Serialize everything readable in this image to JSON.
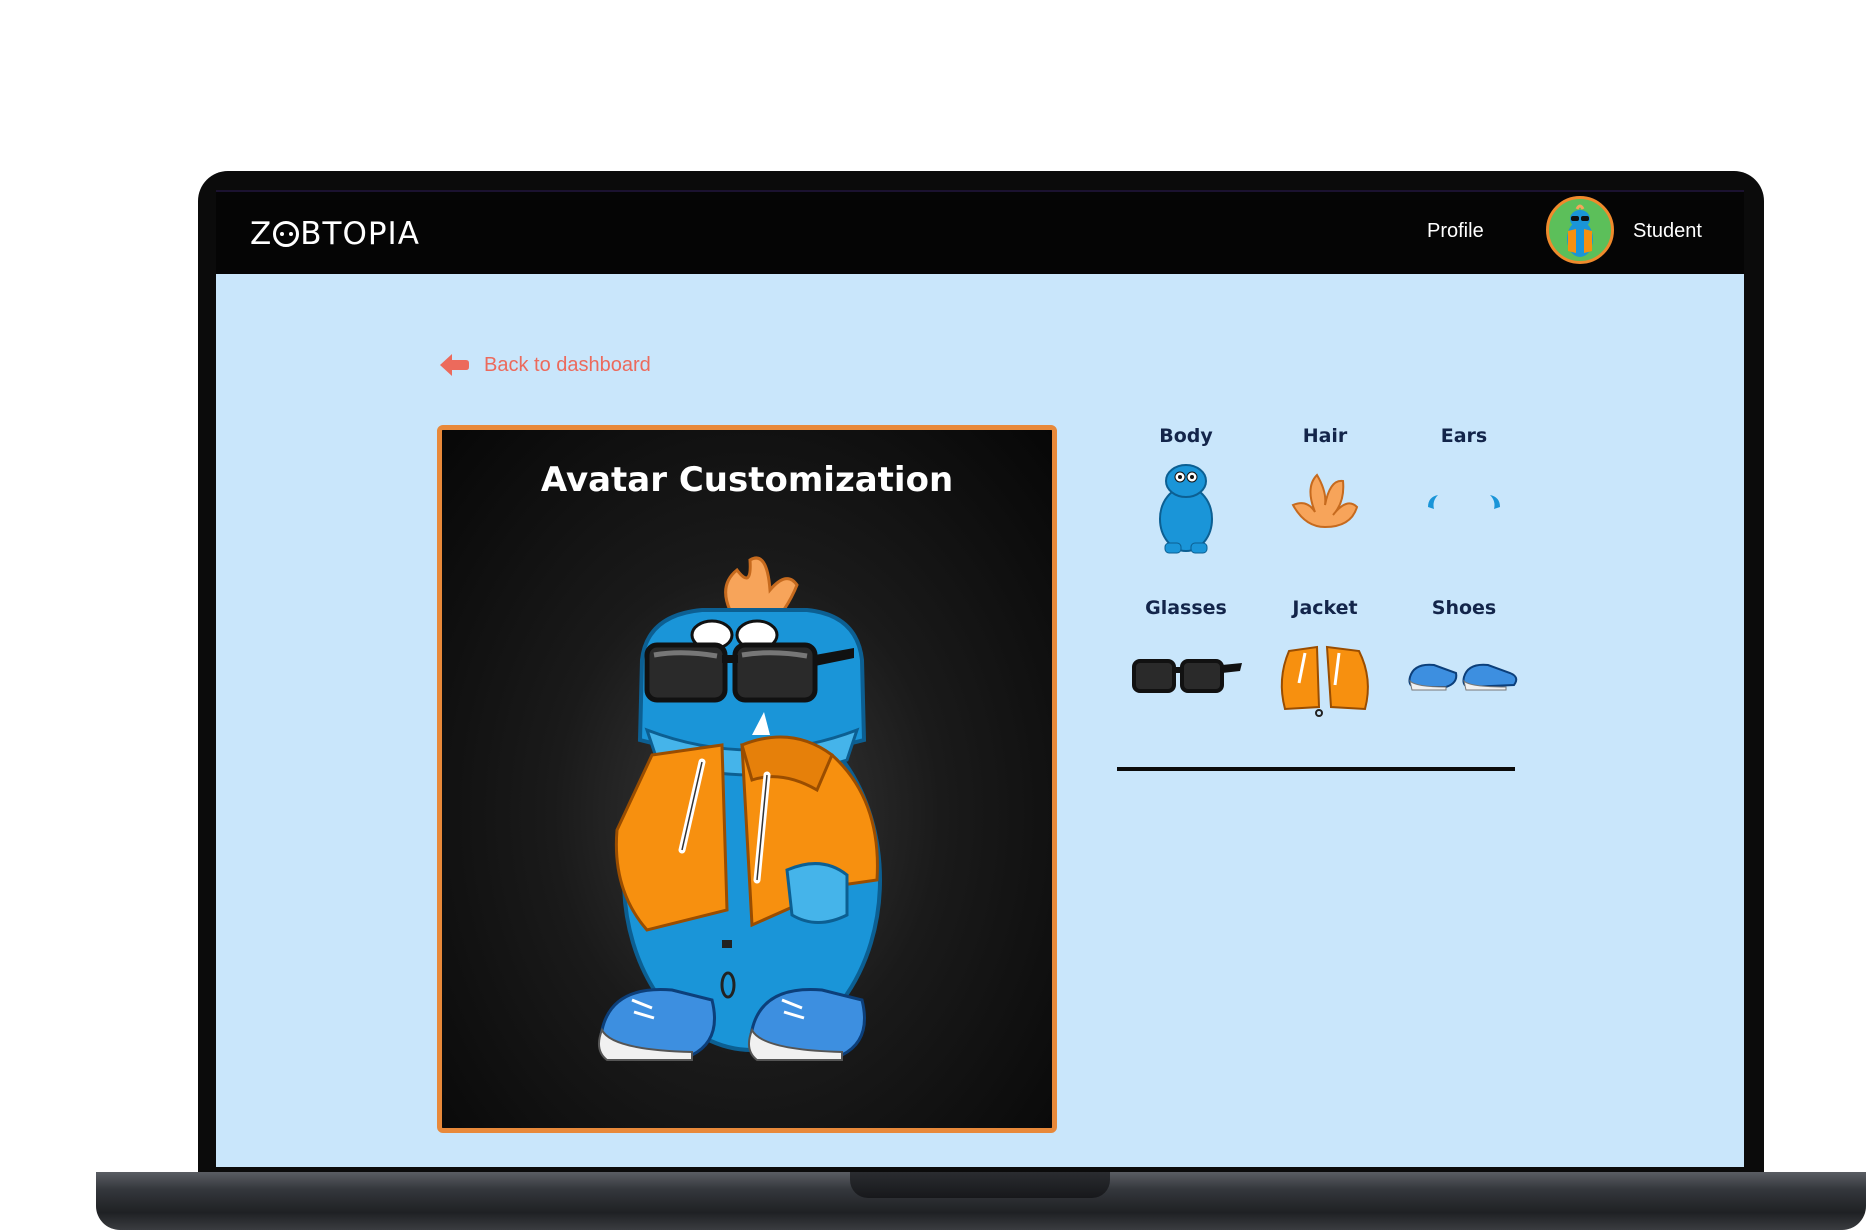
{
  "navbar": {
    "logo_text": "ZOBTOPIA",
    "logo_before": "Z",
    "logo_after": "BTOPIA",
    "profile_link": "Profile",
    "user_name": "Student"
  },
  "back_link": {
    "label": "Back to dashboard"
  },
  "canvas": {
    "title": "Avatar Customization"
  },
  "categories": [
    {
      "label": "Body",
      "icon": "body-icon"
    },
    {
      "label": "Hair",
      "icon": "hair-icon"
    },
    {
      "label": "Ears",
      "icon": "ears-icon"
    },
    {
      "label": "Glasses",
      "icon": "glasses-icon"
    },
    {
      "label": "Jacket",
      "icon": "jacket-icon"
    },
    {
      "label": "Shoes",
      "icon": "shoes-icon"
    }
  ],
  "colors": {
    "accent_orange": "#e8893a",
    "back_link": "#ec6a5c",
    "screen_bg": "#c9e6fb",
    "avatar_blue": "#1a95d8",
    "jacket_orange": "#f7900f"
  }
}
